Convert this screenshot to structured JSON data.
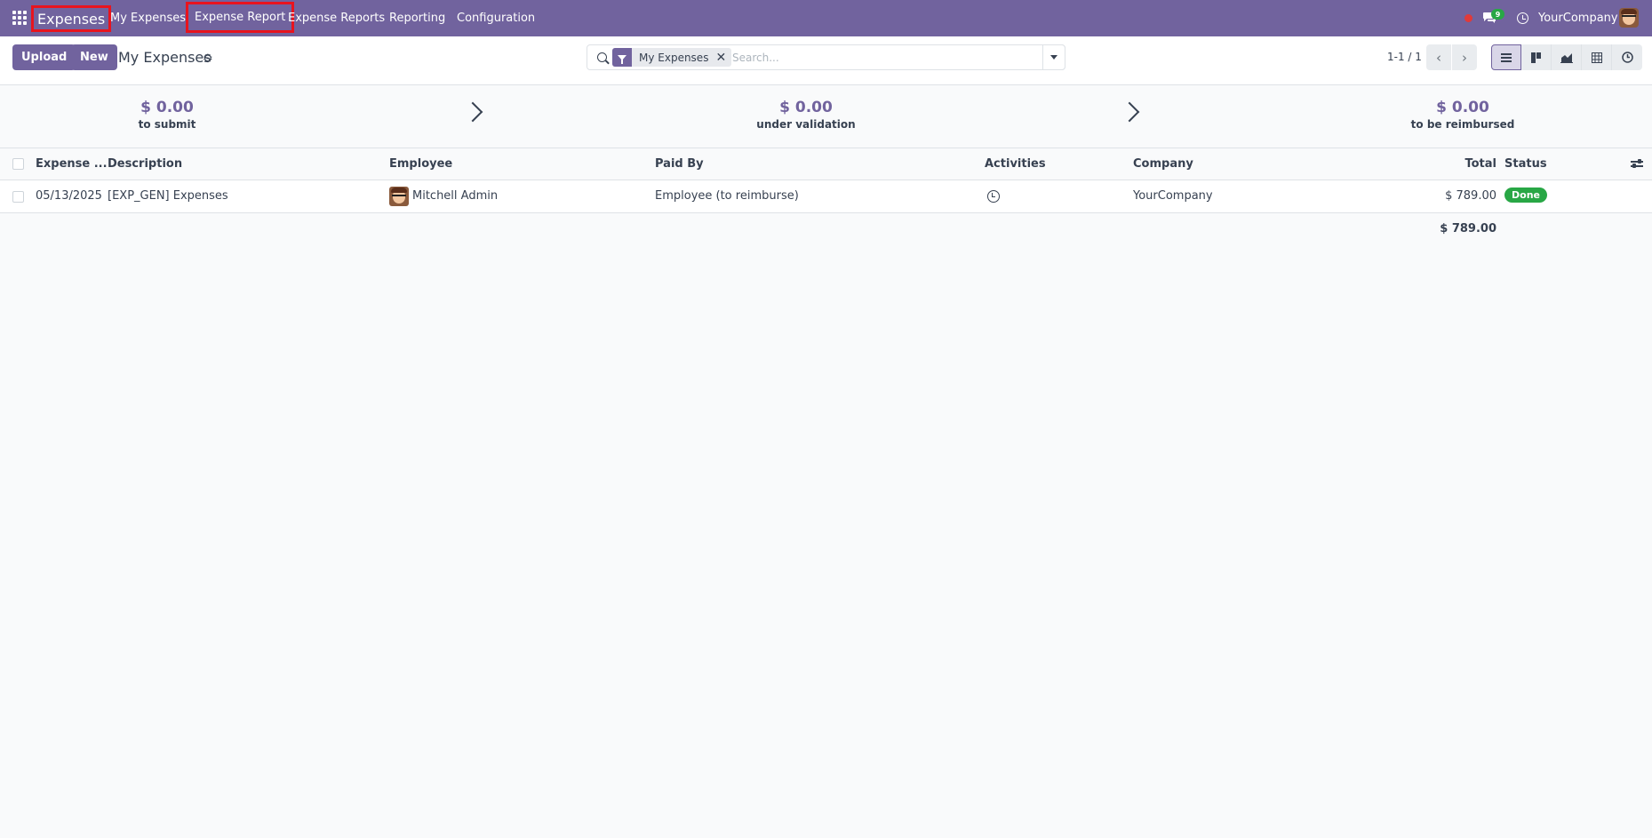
{
  "navbar": {
    "brand": "Expenses",
    "menu": [
      "My Expenses",
      "Expense Report",
      "Expense Reports",
      "Reporting",
      "Configuration"
    ],
    "chat_badge": "9",
    "company": "YourCompany"
  },
  "control_panel": {
    "upload_label": "Upload",
    "new_label": "New",
    "breadcrumb": "My Expenses",
    "facet_label": "My Expenses",
    "facet_close": "✕",
    "search_placeholder": "Search...",
    "pager_value": "1-1 / 1",
    "pager_prev": "‹",
    "pager_next": "›"
  },
  "summary": [
    {
      "amount": "$ 0.00",
      "label": "to submit"
    },
    {
      "amount": "$ 0.00",
      "label": "under validation"
    },
    {
      "amount": "$ 0.00",
      "label": "to be reimbursed"
    }
  ],
  "table": {
    "headers": {
      "date": "Expense ...",
      "description": "Description",
      "employee": "Employee",
      "paid_by": "Paid By",
      "activities": "Activities",
      "company": "Company",
      "total": "Total",
      "status": "Status"
    },
    "rows": [
      {
        "date": "05/13/2025",
        "description": "[EXP_GEN] Expenses",
        "employee": "Mitchell Admin",
        "paid_by": "Employee (to reimburse)",
        "company": "YourCompany",
        "total": "$ 789.00",
        "status": "Done"
      }
    ],
    "grand_total": "$ 789.00"
  },
  "colors": {
    "brand": "#71639e",
    "highlight_box": "#e8141e",
    "status_done": "#28a745"
  },
  "icons": [
    "apps-icon",
    "chat-icon",
    "clock-icon",
    "gear-icon",
    "search-icon",
    "filter-icon",
    "list-view-icon",
    "kanban-view-icon",
    "graph-view-icon",
    "pivot-view-icon",
    "activity-view-icon",
    "activity-icon",
    "column-settings-icon"
  ]
}
